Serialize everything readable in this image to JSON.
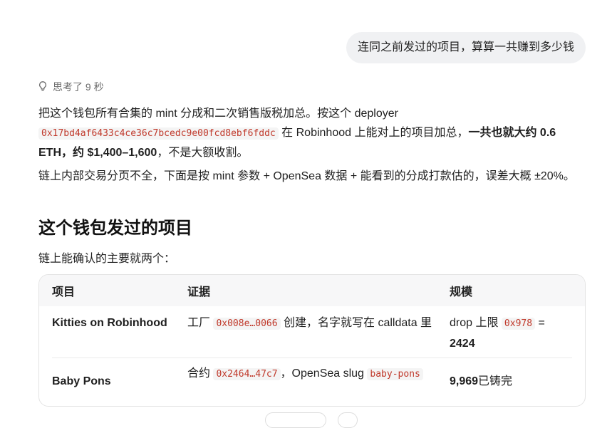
{
  "user_message": "连同之前发过的项目，算算一共赚到多少钱",
  "thought": {
    "label": "思考了 9 秒"
  },
  "para1": {
    "prefix": "把这个钱包所有合集的 mint 分成和二次销售版税加总。按这个 deployer",
    "address": "0x17bd4af6433c4ce36c7bcedc9e00fcd8ebf6fddc",
    "mid": " 在 Robinhood 上能对上的项目加总，",
    "bold": "一共也就大约 0.6 ETH，约 $1,400–1,600",
    "suffix": "，不是大额收割。"
  },
  "para2": "链上内部交易分页不全，下面是按 mint 参数 + OpenSea 数据 + 能看到的分成打款估的，误差大概 ±20%。",
  "section_title": "这个钱包发过的项目",
  "section_sub": "链上能确认的主要就两个：",
  "table": {
    "headers": [
      "项目",
      "证据",
      "规模"
    ],
    "rows": [
      {
        "project": "Kitties on Robinhood",
        "evidence_pre": "工厂 ",
        "evidence_code": "0x008e…0066",
        "evidence_post": " 创建，名字就写在 calldata 里",
        "scale_pre": "drop 上限 ",
        "scale_code": "0x978",
        "scale_mid": " = ",
        "scale_bold": "2424"
      },
      {
        "project": "Baby Pons",
        "evidence_pre": "合约 ",
        "evidence_code": "0x2464…47c7",
        "evidence_post": "，OpenSea slug ",
        "evidence_code2": "baby-pons",
        "scale_bold": "9,969",
        "scale_post": " 已铸完"
      }
    ]
  }
}
